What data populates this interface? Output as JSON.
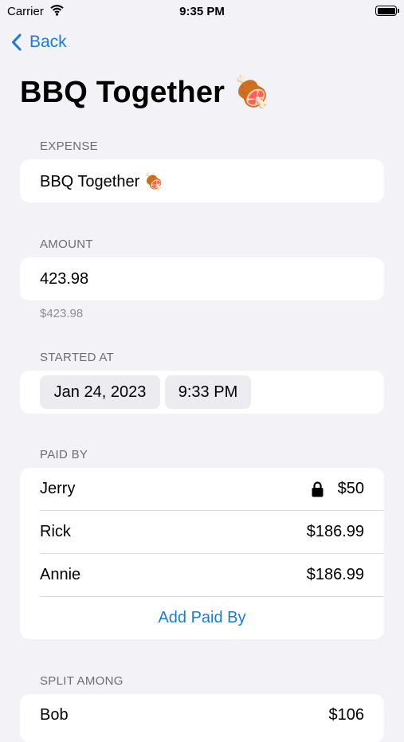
{
  "status_bar": {
    "carrier": "Carrier",
    "time": "9:35 PM"
  },
  "nav": {
    "back_label": "Back"
  },
  "page": {
    "title": "BBQ Together 🍖"
  },
  "expense": {
    "header": "EXPENSE",
    "value": "BBQ Together 🍖"
  },
  "amount": {
    "header": "AMOUNT",
    "value": "423.98",
    "formatted": "$423.98"
  },
  "started_at": {
    "header": "STARTED AT",
    "date": "Jan 24, 2023",
    "time": "9:33 PM"
  },
  "paid_by": {
    "header": "PAID BY",
    "rows": [
      {
        "name": "Jerry",
        "amount": "$50",
        "locked": true
      },
      {
        "name": "Rick",
        "amount": "$186.99",
        "locked": false
      },
      {
        "name": "Annie",
        "amount": "$186.99",
        "locked": false
      }
    ],
    "add_label": "Add Paid By"
  },
  "split_among": {
    "header": "SPLIT AMONG",
    "rows": [
      {
        "name": "Bob",
        "amount": "$106"
      }
    ]
  },
  "colors": {
    "accent": "#1a7bd9",
    "background": "#f2f2f7",
    "card": "#ffffff"
  },
  "icons": [
    "wifi-icon",
    "battery-icon",
    "chevron-left-icon",
    "lock-icon"
  ]
}
